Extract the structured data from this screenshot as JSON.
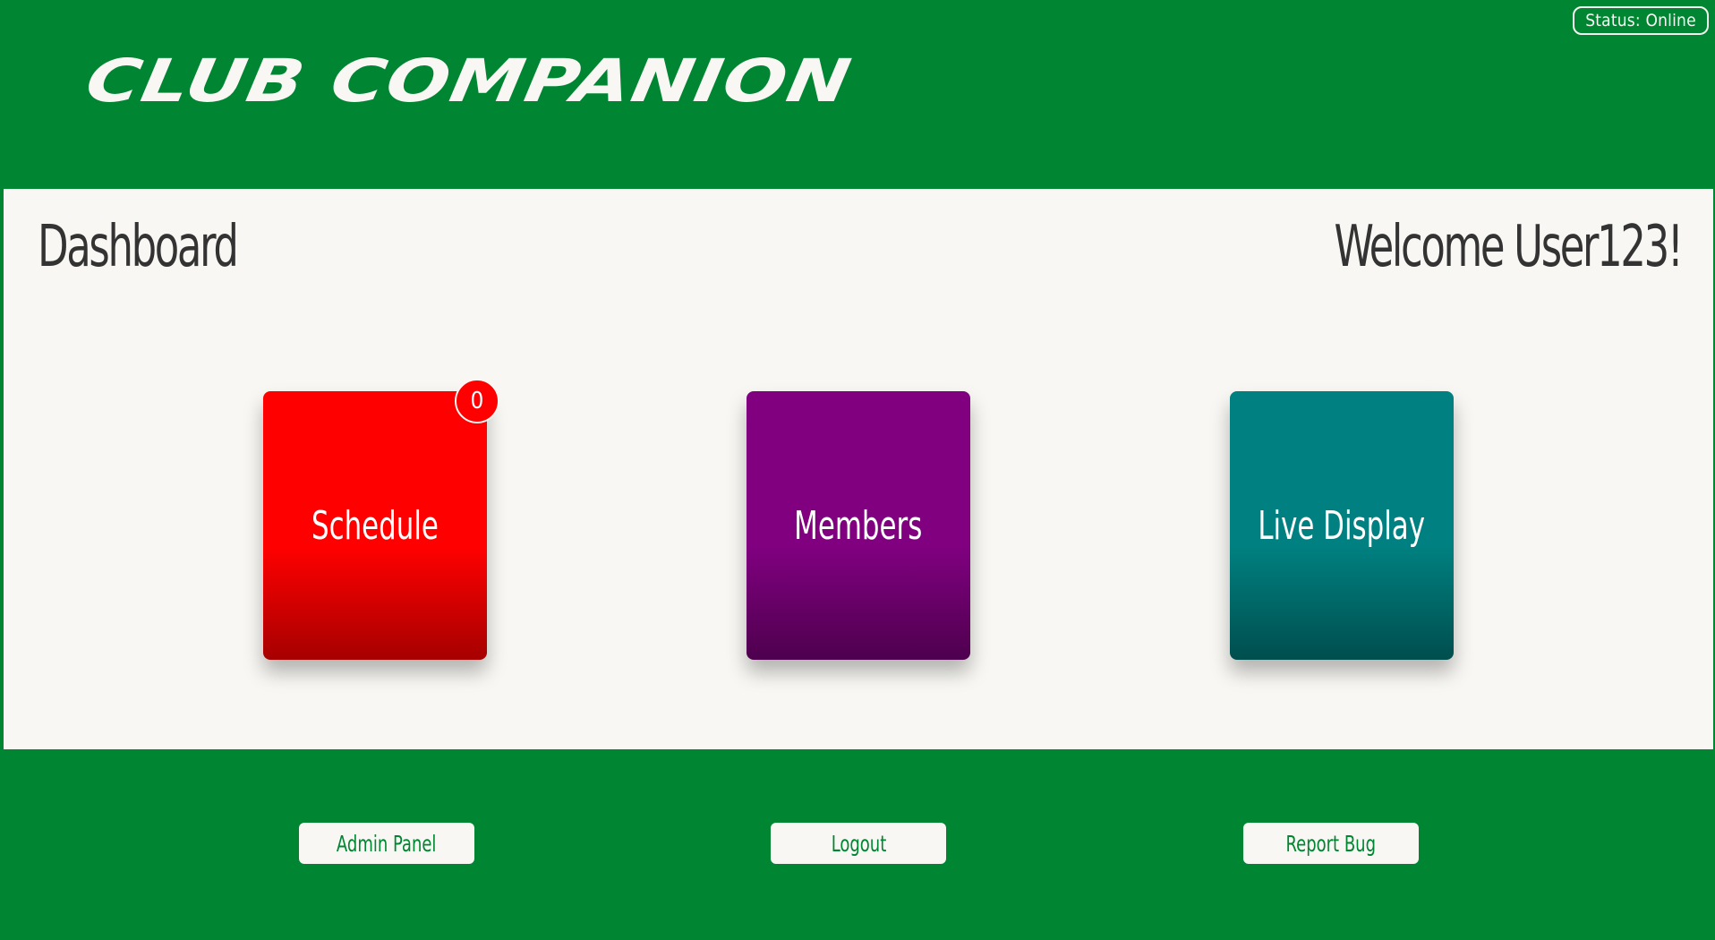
{
  "header": {
    "logo_text": "CLUB COMPANION",
    "status_label": "Status: Online"
  },
  "main": {
    "title": "Dashboard",
    "welcome": "Welcome User123!",
    "cards": [
      {
        "label": "Schedule",
        "badge": "0",
        "color": "#ff0000"
      },
      {
        "label": "Members",
        "color": "#800080"
      },
      {
        "label": "Live Display",
        "color": "#008080"
      }
    ]
  },
  "footer": {
    "buttons": [
      {
        "label": "Admin Panel"
      },
      {
        "label": "Logout"
      },
      {
        "label": "Report Bug"
      }
    ]
  },
  "colors": {
    "brand_green": "#008633",
    "panel_background": "#f8f7f3",
    "text_dark": "#333333"
  }
}
